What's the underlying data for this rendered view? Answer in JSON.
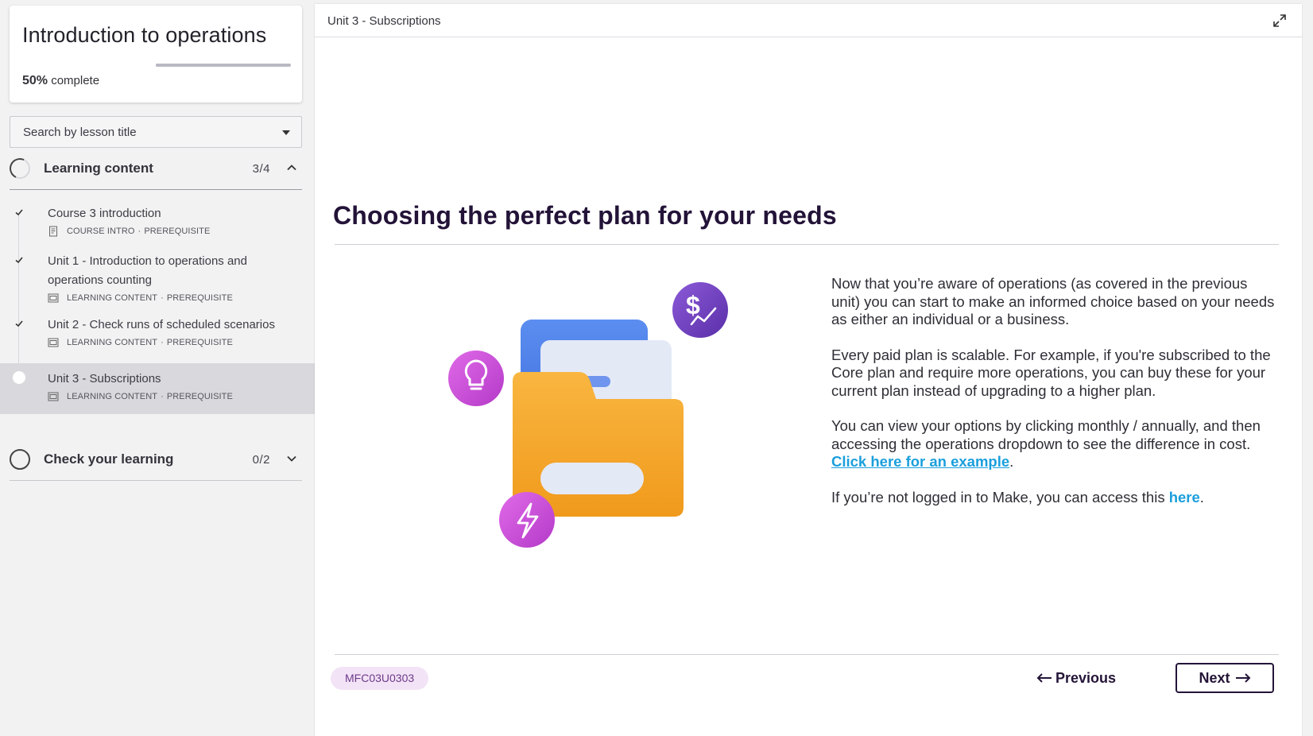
{
  "course": {
    "title": "Introduction to operations",
    "progress_percent": 50,
    "progress_value": "50%",
    "progress_suffix": "complete"
  },
  "search": {
    "placeholder": "Search by lesson title"
  },
  "sections": [
    {
      "label": "Learning content",
      "count": "3/4",
      "expanded": true
    },
    {
      "label": "Check your learning",
      "count": "0/2",
      "expanded": false
    }
  ],
  "lessons": [
    {
      "title": "Course 3 introduction",
      "type": "COURSE INTRO",
      "tag": "PREREQUISITE",
      "completed": true
    },
    {
      "title": "Unit 1 - Introduction to operations and operations counting",
      "type": "LEARNING CONTENT",
      "tag": "PREREQUISITE",
      "completed": true
    },
    {
      "title": "Unit 2 - Check runs of scheduled scenarios",
      "type": "LEARNING CONTENT",
      "tag": "PREREQUISITE",
      "completed": true
    },
    {
      "title": "Unit 3 - Subscriptions",
      "type": "LEARNING CONTENT",
      "tag": "PREREQUISITE",
      "completed": false,
      "active": true
    }
  ],
  "meta_separator": "·",
  "main": {
    "breadcrumb": "Unit 3 - Subscriptions",
    "heading": "Choosing the perfect plan for your needs",
    "paragraphs": [
      "Now that you’re aware of operations (as covered in the previous unit) you can start to make an informed choice based on your needs as either an individual or a business.",
      "Every paid plan is scalable. For example, if you're subscribed to the Core plan and require more operations, you can buy these for your current plan instead of upgrading to a higher plan."
    ],
    "p3_text": "You can view your options by clicking monthly / annually, and then accessing the operations dropdown to see the difference in cost. ",
    "p3_link": "Click here for an example",
    "p3_end": ".",
    "p4_text": "If you’re not logged in to Make, you can access this ",
    "p4_link": "here",
    "p4_end": ".",
    "code": "MFC03U0303",
    "prev_label": "Previous",
    "next_label": "Next"
  },
  "icons": {
    "illustration": "folder-documents-illustration",
    "badges": [
      "lightbulb-icon",
      "dollar-chart-icon",
      "lightning-icon"
    ]
  },
  "colors": {
    "heading": "#231338",
    "link": "#1a9fdc",
    "badge_bg": "#f3e3f6",
    "accent_purple": "#6e3fb8",
    "accent_magenta": "#c43fd6",
    "folder": "#f5a623"
  }
}
